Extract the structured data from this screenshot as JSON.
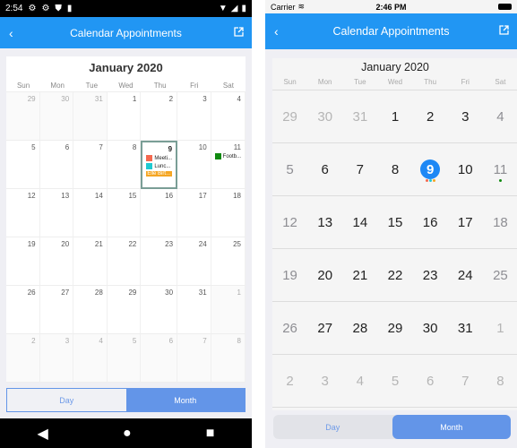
{
  "android": {
    "status": {
      "time": "2:54"
    },
    "nav": {
      "title": "Calendar Appointments",
      "back_icon": "chevron-left-icon",
      "action_icon": "open-external-icon"
    },
    "calendar": {
      "title": "January 2020",
      "days_of_week": [
        "Sun",
        "Mon",
        "Tue",
        "Wed",
        "Thu",
        "Fri",
        "Sat"
      ],
      "weeks": [
        [
          {
            "d": "29",
            "o": 1
          },
          {
            "d": "30",
            "o": 1
          },
          {
            "d": "31",
            "o": 1
          },
          {
            "d": "1"
          },
          {
            "d": "2"
          },
          {
            "d": "3"
          },
          {
            "d": "4"
          }
        ],
        [
          {
            "d": "5"
          },
          {
            "d": "6"
          },
          {
            "d": "7"
          },
          {
            "d": "8"
          },
          {
            "d": "9",
            "sel": 1
          },
          {
            "d": "10"
          },
          {
            "d": "11"
          }
        ],
        [
          {
            "d": "12"
          },
          {
            "d": "13"
          },
          {
            "d": "14"
          },
          {
            "d": "15"
          },
          {
            "d": "16"
          },
          {
            "d": "17"
          },
          {
            "d": "18"
          }
        ],
        [
          {
            "d": "19"
          },
          {
            "d": "20"
          },
          {
            "d": "21"
          },
          {
            "d": "22"
          },
          {
            "d": "23"
          },
          {
            "d": "24"
          },
          {
            "d": "25"
          }
        ],
        [
          {
            "d": "26"
          },
          {
            "d": "27"
          },
          {
            "d": "28"
          },
          {
            "d": "29"
          },
          {
            "d": "30"
          },
          {
            "d": "31"
          },
          {
            "d": "1",
            "o": 1
          }
        ],
        [
          {
            "d": "2",
            "o": 1
          },
          {
            "d": "3",
            "o": 1
          },
          {
            "d": "4",
            "o": 1
          },
          {
            "d": "5",
            "o": 1
          },
          {
            "d": "6",
            "o": 1
          },
          {
            "d": "7",
            "o": 1
          },
          {
            "d": "8",
            "o": 1
          }
        ]
      ],
      "appointments": {
        "9": [
          {
            "label": "Meeti...",
            "color": "#f4694f"
          },
          {
            "label": "Lunc...",
            "color": "#1fc9d1"
          },
          {
            "label": "Elle Birt...",
            "color": "#f5a623",
            "full": true
          }
        ],
        "11": [
          {
            "label": "Footb...",
            "color": "#108a10"
          }
        ]
      }
    },
    "segments": {
      "day": "Day",
      "month": "Month",
      "selected": "Month"
    }
  },
  "ios": {
    "status": {
      "carrier": "Carrier",
      "time": "2:46 PM"
    },
    "nav": {
      "title": "Calendar Appointments"
    },
    "calendar": {
      "title": "January 2020"
    },
    "segments": {
      "day": "Day",
      "month": "Month",
      "selected": "Month"
    },
    "dot_colors": {
      "9": [
        "#f4694f",
        "#1fc9d1",
        "#f5a623"
      ],
      "11": [
        "#108a10"
      ]
    }
  }
}
